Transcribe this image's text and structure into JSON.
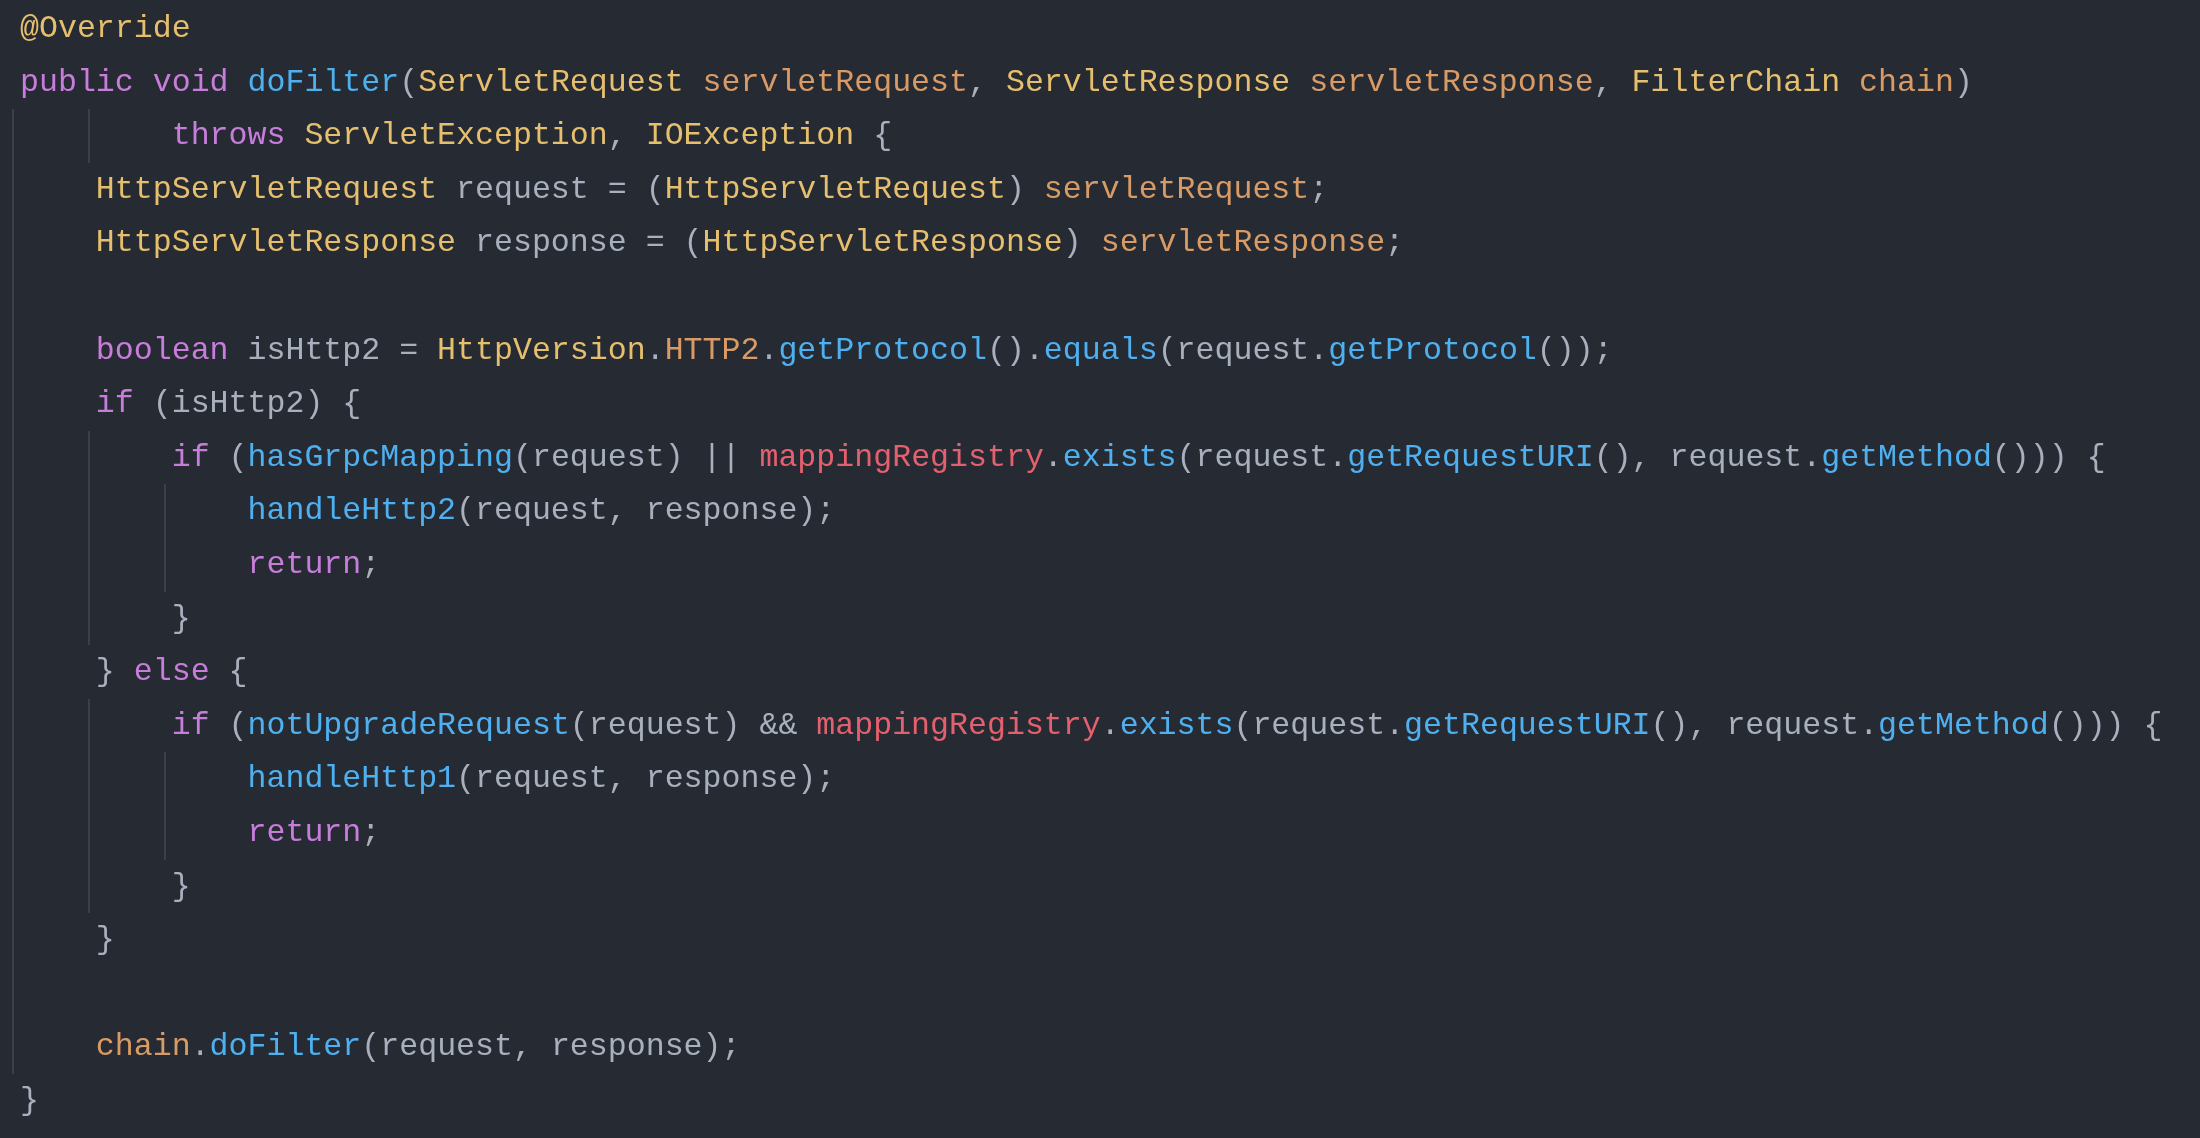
{
  "editor": {
    "lines": [
      {
        "kind": "code",
        "tokens": [
          {
            "kind": "annotation",
            "text": "@Override"
          }
        ]
      },
      {
        "kind": "code",
        "tokens": [
          {
            "kind": "keyword",
            "text": "public void "
          },
          {
            "kind": "function",
            "text": "doFilter"
          },
          {
            "kind": "plain",
            "text": "("
          },
          {
            "kind": "type",
            "text": "ServletRequest "
          },
          {
            "kind": "param",
            "text": "servletRequest"
          },
          {
            "kind": "plain",
            "text": ", "
          },
          {
            "kind": "type",
            "text": "ServletResponse "
          },
          {
            "kind": "param",
            "text": "servletResponse"
          },
          {
            "kind": "plain",
            "text": ", "
          },
          {
            "kind": "type",
            "text": "FilterChain "
          },
          {
            "kind": "param",
            "text": "chain"
          },
          {
            "kind": "plain",
            "text": ")"
          }
        ]
      },
      {
        "kind": "code",
        "tokens": [
          {
            "kind": "keyword",
            "text": "        throws "
          },
          {
            "kind": "type",
            "text": "ServletException"
          },
          {
            "kind": "plain",
            "text": ", "
          },
          {
            "kind": "type",
            "text": "IOException"
          },
          {
            "kind": "plain",
            "text": " {"
          }
        ]
      },
      {
        "kind": "code",
        "tokens": [
          {
            "kind": "type",
            "text": "    HttpServletRequest "
          },
          {
            "kind": "plain",
            "text": "request = ("
          },
          {
            "kind": "type",
            "text": "HttpServletRequest"
          },
          {
            "kind": "plain",
            "text": ") "
          },
          {
            "kind": "param",
            "text": "servletRequest"
          },
          {
            "kind": "plain",
            "text": ";"
          }
        ]
      },
      {
        "kind": "code",
        "tokens": [
          {
            "kind": "type",
            "text": "    HttpServletResponse "
          },
          {
            "kind": "plain",
            "text": "response = ("
          },
          {
            "kind": "type",
            "text": "HttpServletResponse"
          },
          {
            "kind": "plain",
            "text": ") "
          },
          {
            "kind": "param",
            "text": "servletResponse"
          },
          {
            "kind": "plain",
            "text": ";"
          }
        ]
      },
      {
        "kind": "blank"
      },
      {
        "kind": "code",
        "tokens": [
          {
            "kind": "keyword",
            "text": "    boolean "
          },
          {
            "kind": "plain",
            "text": "isHttp2 = "
          },
          {
            "kind": "type",
            "text": "HttpVersion"
          },
          {
            "kind": "plain",
            "text": "."
          },
          {
            "kind": "param",
            "text": "HTTP2"
          },
          {
            "kind": "plain",
            "text": "."
          },
          {
            "kind": "function",
            "text": "getProtocol"
          },
          {
            "kind": "plain",
            "text": "()."
          },
          {
            "kind": "function",
            "text": "equals"
          },
          {
            "kind": "plain",
            "text": "(request."
          },
          {
            "kind": "function",
            "text": "getProtocol"
          },
          {
            "kind": "plain",
            "text": "());"
          }
        ]
      },
      {
        "kind": "code",
        "tokens": [
          {
            "kind": "keyword",
            "text": "    if "
          },
          {
            "kind": "plain",
            "text": "(isHttp2) {"
          }
        ]
      },
      {
        "kind": "code",
        "tokens": [
          {
            "kind": "keyword",
            "text": "        if "
          },
          {
            "kind": "plain",
            "text": "("
          },
          {
            "kind": "function",
            "text": "hasGrpcMapping"
          },
          {
            "kind": "plain",
            "text": "(request) || "
          },
          {
            "kind": "field",
            "text": "mappingRegistry"
          },
          {
            "kind": "plain",
            "text": "."
          },
          {
            "kind": "function",
            "text": "exists"
          },
          {
            "kind": "plain",
            "text": "(request."
          },
          {
            "kind": "function",
            "text": "getRequestURI"
          },
          {
            "kind": "plain",
            "text": "(), request."
          },
          {
            "kind": "function",
            "text": "getMethod"
          },
          {
            "kind": "plain",
            "text": "())) {"
          }
        ]
      },
      {
        "kind": "code",
        "tokens": [
          {
            "kind": "function",
            "text": "            handleHttp2"
          },
          {
            "kind": "plain",
            "text": "(request, response);"
          }
        ]
      },
      {
        "kind": "code",
        "tokens": [
          {
            "kind": "keyword",
            "text": "            return"
          },
          {
            "kind": "plain",
            "text": ";"
          }
        ]
      },
      {
        "kind": "code",
        "tokens": [
          {
            "kind": "plain",
            "text": "        }"
          }
        ]
      },
      {
        "kind": "code",
        "tokens": [
          {
            "kind": "plain",
            "text": "    } "
          },
          {
            "kind": "keyword",
            "text": "else"
          },
          {
            "kind": "plain",
            "text": " {"
          }
        ]
      },
      {
        "kind": "code",
        "tokens": [
          {
            "kind": "keyword",
            "text": "        if "
          },
          {
            "kind": "plain",
            "text": "("
          },
          {
            "kind": "function",
            "text": "notUpgradeRequest"
          },
          {
            "kind": "plain",
            "text": "(request) && "
          },
          {
            "kind": "field",
            "text": "mappingRegistry"
          },
          {
            "kind": "plain",
            "text": "."
          },
          {
            "kind": "function",
            "text": "exists"
          },
          {
            "kind": "plain",
            "text": "(request."
          },
          {
            "kind": "function",
            "text": "getRequestURI"
          },
          {
            "kind": "plain",
            "text": "(), request."
          },
          {
            "kind": "function",
            "text": "getMethod"
          },
          {
            "kind": "plain",
            "text": "())) {"
          }
        ]
      },
      {
        "kind": "code",
        "tokens": [
          {
            "kind": "function",
            "text": "            handleHttp1"
          },
          {
            "kind": "plain",
            "text": "(request, response);"
          }
        ]
      },
      {
        "kind": "code",
        "tokens": [
          {
            "kind": "keyword",
            "text": "            return"
          },
          {
            "kind": "plain",
            "text": ";"
          }
        ]
      },
      {
        "kind": "code",
        "tokens": [
          {
            "kind": "plain",
            "text": "        }"
          }
        ]
      },
      {
        "kind": "code",
        "tokens": [
          {
            "kind": "plain",
            "text": "    }"
          }
        ]
      },
      {
        "kind": "blank"
      },
      {
        "kind": "code",
        "tokens": [
          {
            "kind": "param",
            "text": "    chain"
          },
          {
            "kind": "plain",
            "text": "."
          },
          {
            "kind": "function",
            "text": "doFilter"
          },
          {
            "kind": "plain",
            "text": "(request, response);"
          }
        ]
      },
      {
        "kind": "code",
        "tokens": [
          {
            "kind": "plain",
            "text": "}"
          }
        ]
      }
    ]
  }
}
